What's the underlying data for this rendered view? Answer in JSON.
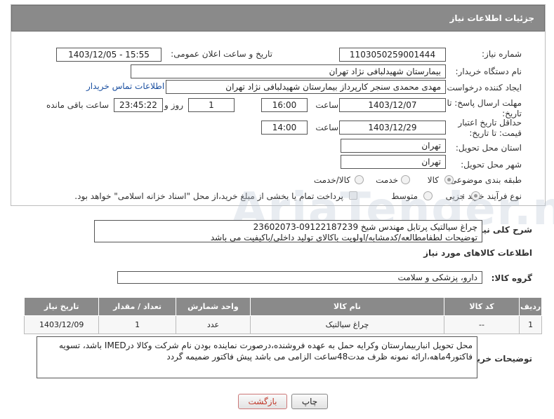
{
  "header": {
    "title": "جزئیات اطلاعات نیاز"
  },
  "form": {
    "need_number_label": "شماره نیاز:",
    "need_number": "1103050259001444",
    "announce_label": "تاریخ و ساعت اعلان عمومی:",
    "announce_value": "1403/12/05 - 15:55",
    "buyer_org_label": "نام دستگاه خریدار:",
    "buyer_org": "بیمارستان شهیدلبافی نژاد تهران",
    "creator_label": "ایجاد کننده درخواست:",
    "creator": "مهدی محمدی سنجر کارپرداز بیمارستان شهیدلبافی نژاد تهران",
    "contact_link": "اطلاعات تماس خریدار",
    "deadline_label": "مهلت ارسال پاسخ: تا تاریخ:",
    "deadline_date": "1403/12/07",
    "time_label": "ساعت",
    "deadline_time": "16:00",
    "days_value": "1",
    "days_label": "روز و",
    "remaining_time": "23:45:22",
    "remaining_label": "ساعت باقی مانده",
    "validity_label": "حداقل تاریخ اعتبار قیمت: تا تاریخ:",
    "validity_date": "1403/12/29",
    "validity_time": "14:00",
    "province_label": "استان محل تحویل:",
    "province": "تهران",
    "city_label": "شهر محل تحویل:",
    "city": "تهران",
    "category_label": "طبقه بندی موضوعی:",
    "category_options": [
      "کالا",
      "خدمت",
      "کالا/خدمت"
    ],
    "category_selected": "کالا",
    "process_label": "نوع فرآیند خرید :",
    "process_options": [
      "جزیی",
      "متوسط"
    ],
    "process_selected": "جزیی",
    "payment_note": "پرداخت تمام یا بخشی از مبلغ خرید،از محل \"اسناد خزانه اسلامی\" خواهد بود."
  },
  "description": {
    "label": "شرح کلی نیاز:",
    "line1": "چراغ سیالتیک پرتابل مهندس شیخ 09122187239-23602073",
    "line2": "توضیحات لطفامطالعه/کدمشابه/اولویت باکالای تولید داخلی/باکیفیت می باشد"
  },
  "goods_info": {
    "title": "اطلاعات کالاهای مورد نیاز"
  },
  "goods_group": {
    "label": "گروه کالا:",
    "value": "دارو، پزشکی و سلامت"
  },
  "table": {
    "headers": [
      "ردیف",
      "کد کالا",
      "نام کالا",
      "واحد شمارش",
      "تعداد / مقدار",
      "تاریخ نیاز"
    ],
    "rows": [
      {
        "row": "1",
        "code": "--",
        "name": "چراغ سیالتیک",
        "unit": "عدد",
        "qty": "1",
        "date": "1403/12/09"
      }
    ]
  },
  "buyer_notes": {
    "label": "توضیحات خریدار:",
    "line1": "محل تحویل انباربیمارستان وکرایه حمل به عهده فروشنده،درصورت نماینده بودن نام شرکت وکالا درIMED باشد، تسویه",
    "line2": "فاکتور4ماهه،ارائه نمونه ظرف مدت48ساعت الزامی می باشد پیش فاکتور ضمیمه گردد"
  },
  "buttons": {
    "print": "چاپ",
    "back": "بازگشت"
  },
  "colors": {
    "header_bg": "#8a8a8a",
    "link": "#1a4fa0",
    "back_btn_text": "#c0392b"
  }
}
